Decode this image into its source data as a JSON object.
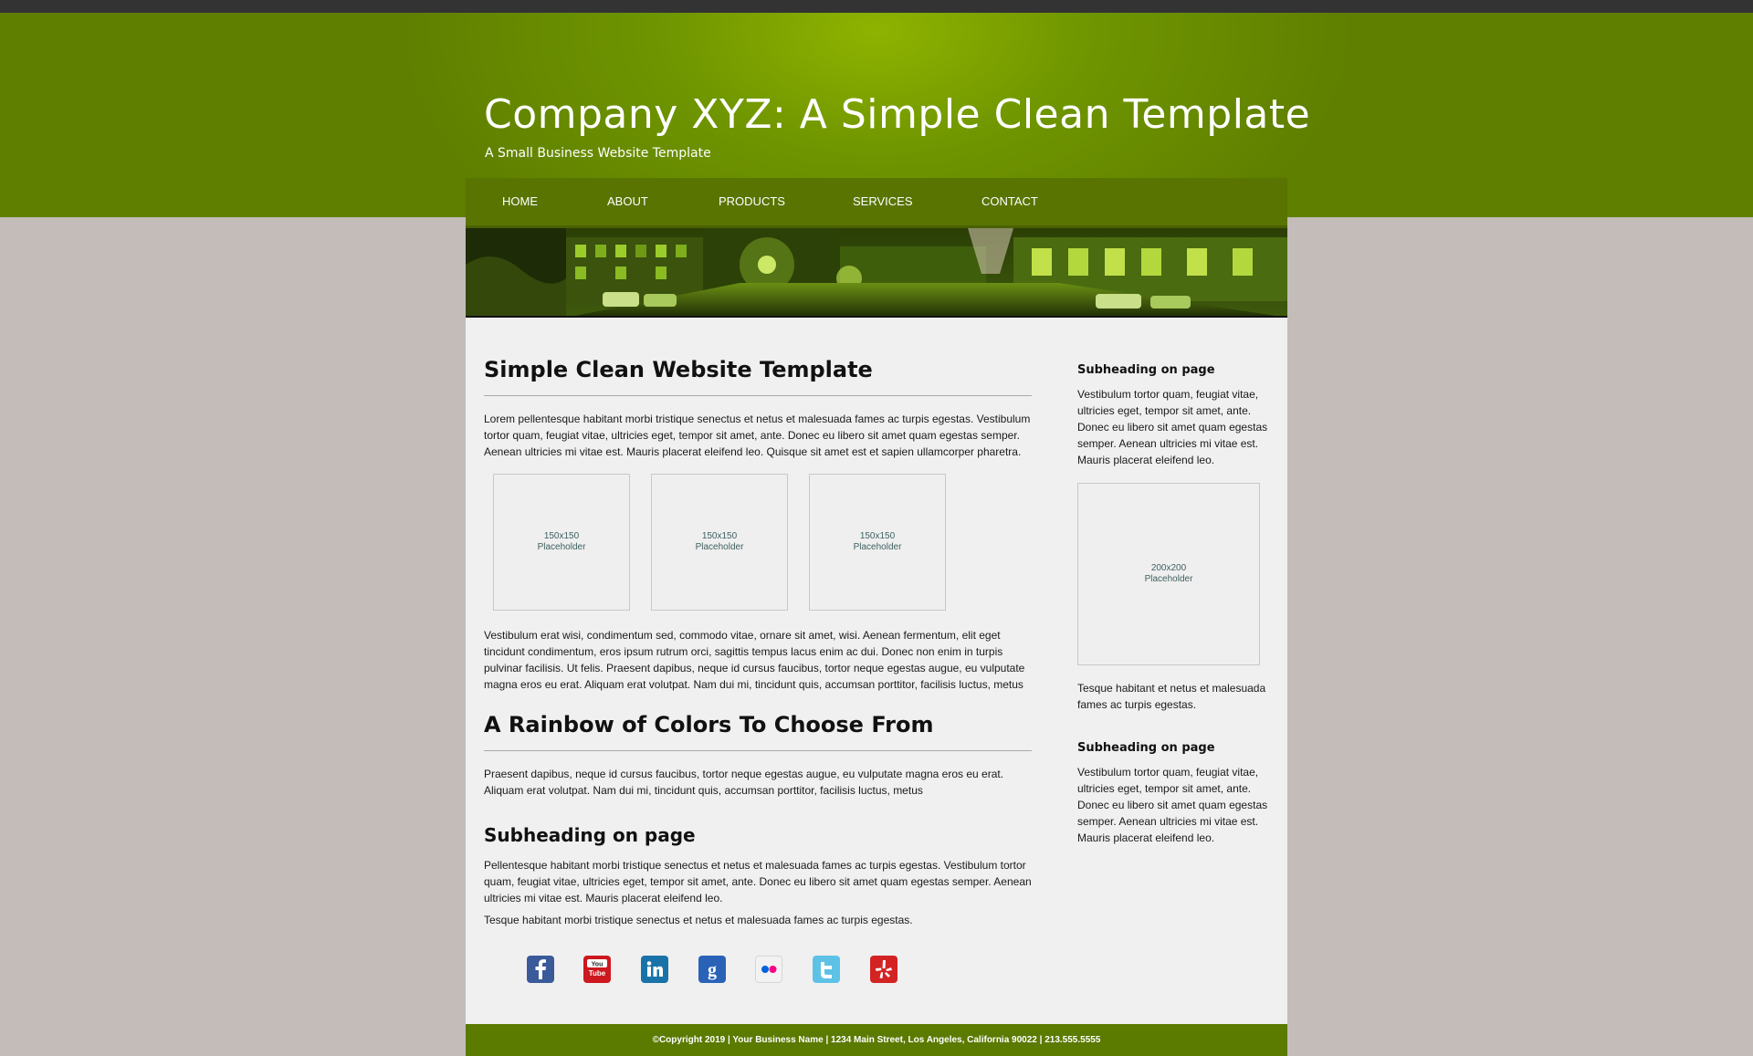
{
  "header": {
    "title": "Company XYZ: A Simple Clean Template",
    "tagline": "A Small Business Website Template"
  },
  "nav": {
    "items": [
      {
        "label": "HOME"
      },
      {
        "label": "ABOUT"
      },
      {
        "label": "PRODUCTS"
      },
      {
        "label": "SERVICES"
      },
      {
        "label": "CONTACT"
      }
    ]
  },
  "main": {
    "heading1": "Simple Clean Website Template",
    "para1": "Lorem pellentesque habitant morbi tristique senectus et netus et malesuada fames ac turpis egestas. Vestibulum tortor quam, feugiat vitae, ultricies eget, tempor sit amet, ante. Donec eu libero sit amet quam egestas semper. Aenean ultricies mi vitae est. Mauris placerat eleifend leo. Quisque sit amet est et sapien ullamcorper pharetra.",
    "placeholders": [
      {
        "size": "150x150",
        "label": "Placeholder"
      },
      {
        "size": "150x150",
        "label": "Placeholder"
      },
      {
        "size": "150x150",
        "label": "Placeholder"
      }
    ],
    "para2": "Vestibulum erat wisi, condimentum sed, commodo vitae, ornare sit amet, wisi. Aenean fermentum, elit eget tincidunt condimentum, eros ipsum rutrum orci, sagittis tempus lacus enim ac dui. Donec non enim in turpis pulvinar facilisis. Ut felis. Praesent dapibus, neque id cursus faucibus, tortor neque egestas augue, eu vulputate magna eros eu erat. Aliquam erat volutpat. Nam dui mi, tincidunt quis, accumsan porttitor, facilisis luctus, metus",
    "heading2": "A Rainbow of Colors To Choose From",
    "para3": "Praesent dapibus, neque id cursus faucibus, tortor neque egestas augue, eu vulputate magna eros eu erat. Aliquam erat volutpat. Nam dui mi, tincidunt quis, accumsan porttitor, facilisis luctus, metus",
    "subheading": "Subheading on page",
    "para4": "Pellentesque habitant morbi tristique senectus et netus et malesuada fames ac turpis egestas. Vestibulum tortor quam, feugiat vitae, ultricies eget, tempor sit amet, ante. Donec eu libero sit amet quam egestas semper. Aenean ultricies mi vitae est. Mauris placerat eleifend leo.",
    "para5": "Tesque habitant morbi tristique senectus et netus et malesuada fames ac turpis egestas."
  },
  "sidebar": {
    "heading1": "Subheading on page",
    "text1": "Vestibulum tortor quam, feugiat vitae, ultricies eget, tempor sit amet, ante. Donec eu libero sit amet quam egestas semper. Aenean ultricies mi vitae est. Mauris placerat eleifend leo.",
    "placeholder": {
      "size": "200x200",
      "label": "Placeholder"
    },
    "text2": "Tesque habitant et netus et malesuada fames ac turpis egestas.",
    "heading2": "Subheading on page",
    "text3": "Vestibulum tortor quam, feugiat vitae, ultricies eget, tempor sit amet, ante. Donec eu libero sit amet quam egestas semper. Aenean ultricies mi vitae est. Mauris placerat eleifend leo."
  },
  "social": [
    {
      "icon": "facebook-icon",
      "color": "#3b5a9a"
    },
    {
      "icon": "youtube-icon",
      "color": "#cc181e"
    },
    {
      "icon": "linkedin-icon",
      "color": "#1a73a8"
    },
    {
      "icon": "google-icon",
      "color": "#2a62b8"
    },
    {
      "icon": "flickr-icon",
      "color": "#f2f2f2"
    },
    {
      "icon": "twitter-icon",
      "color": "#5ec2e6"
    },
    {
      "icon": "yelp-icon",
      "color": "#d32323"
    }
  ],
  "footer": {
    "text": "©Copyright 2019 | Your Business Name | 1234 Main Street, Los Angeles, California 90022 | 213.555.5555"
  },
  "colors": {
    "header_green": "#6f9500",
    "nav_green": "#597400",
    "footer_green": "#5a7a00",
    "page_background": "#c3bcb8",
    "content_background": "#f0f0f0"
  }
}
